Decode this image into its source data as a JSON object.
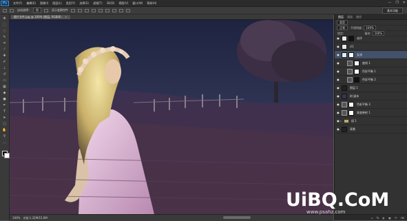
{
  "app": {
    "logo": "Ps"
  },
  "menu": [
    "文件(F)",
    "编辑(E)",
    "图像(I)",
    "图层(L)",
    "类型(Y)",
    "选择(S)",
    "滤镜(T)",
    "3D(D)",
    "视图(V)",
    "窗口(W)",
    "帮助(H)"
  ],
  "window_controls": [
    "—",
    "❐",
    "✕"
  ],
  "options": {
    "auto_select_label": "自动选择：",
    "auto_select_value": "组",
    "transform_label": "显示变换控件",
    "workspace": "基本功能"
  },
  "document": {
    "tab_label": "图片文件.jpg @ 100% (图层, RGB/8)",
    "close": "×"
  },
  "status": {
    "zoom": "100%",
    "doc_info": "文档:1.32M/15.6M"
  },
  "panel": {
    "tabs": [
      "图层",
      "通道",
      "路径"
    ],
    "kind_label": "类型",
    "blend_mode": "正常",
    "opacity_label": "不透明度:",
    "opacity_value": "100%",
    "lock_label": "锁定:",
    "fill_label": "填充:",
    "fill_value": "100%"
  },
  "layers": [
    {
      "name": "花环",
      "thumb": "light",
      "mask": false,
      "indent": false
    },
    {
      "name": "cl1",
      "thumb": "light",
      "mask": false,
      "indent": false
    },
    {
      "name": "女孩",
      "thumb": "light",
      "mask": false,
      "indent": false,
      "selected": true
    },
    {
      "name": "曲线 1",
      "thumb": "adj",
      "mask": true,
      "indent": true
    },
    {
      "name": "色彩平衡 1",
      "thumb": "adj",
      "mask": true,
      "indent": true
    },
    {
      "name": "色彩平衡 2",
      "thumb": "adj",
      "mask": true,
      "indent": true
    },
    {
      "name": "图层 1",
      "thumb": "dark",
      "mask": false,
      "indent": false
    },
    {
      "name": "树 副本",
      "thumb": "photo",
      "mask": false,
      "indent": false
    },
    {
      "name": "色彩平衡 3",
      "thumb": "adj",
      "mask": true,
      "indent": false
    },
    {
      "name": "渐变映射 1",
      "thumb": "adj",
      "mask": true,
      "indent": false
    },
    {
      "name": "组 1",
      "thumb": "folder",
      "mask": false,
      "indent": false
    },
    {
      "name": "背景",
      "thumb": "dark",
      "mask": false,
      "indent": false
    }
  ],
  "panel_footer": [
    "fx",
    "◐",
    "▣",
    "❒",
    "🗑"
  ],
  "watermark": {
    "main": "UiBQ.CoM",
    "url": "www.psahz.com"
  }
}
